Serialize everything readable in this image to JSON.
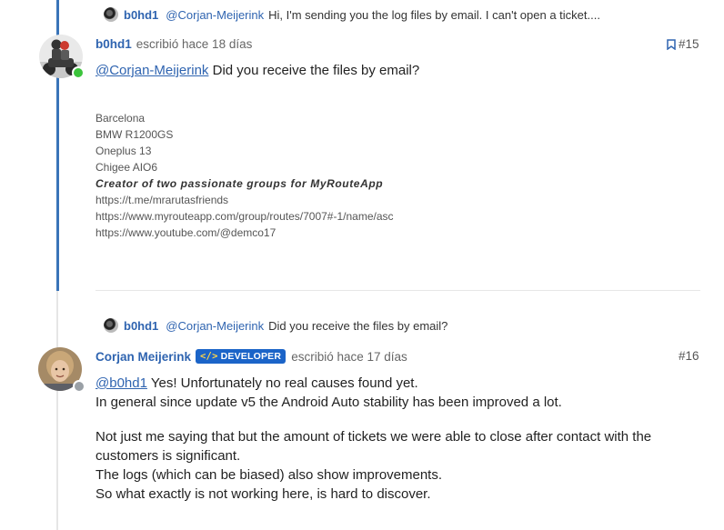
{
  "post1": {
    "reply_to": {
      "username": "b0hd1",
      "mention": "@Corjan-Meijerink",
      "text": "Hi, I'm sending you the log files by email. I can't open a ticket...."
    },
    "username": "b0hd1",
    "posted": "escribió hace 18 días",
    "number": "#15",
    "mention": "@Corjan-Meijerink",
    "text": " Did you receive the files by email?",
    "signature": {
      "lines": [
        "Barcelona",
        "BMW R1200GS",
        "Oneplus 13",
        "Chigee AIO6"
      ],
      "bold_line": "Creator of two passionate groups for MyRouteApp",
      "links": [
        "https://t.me/mrarutasfriends",
        "https://www.myrouteapp.com/group/routes/7007#-1/name/asc",
        "https://www.youtube.com/@demco17"
      ]
    }
  },
  "post2": {
    "reply_to": {
      "username": "b0hd1",
      "mention": "@Corjan-Meijerink",
      "text": "Did you receive the files by email?"
    },
    "username": "Corjan Meijerink",
    "badge": "DEVELOPER",
    "badge_icon": "</>",
    "posted": "escribió hace 17 días",
    "number": "#16",
    "mention": "@b0hd1",
    "p1_line1": " Yes! Unfortunately no real causes found yet.",
    "p1_line2": "In general since update v5 the Android Auto stability has been improved a lot.",
    "p2_line1": "Not just me saying that but the amount of tickets we were able to close after contact with the",
    "p2_line2": "customers is significant.",
    "p2_line3": "The logs (which can be biased) also show improvements.",
    "p2_line4": "So what exactly is not working here, is hard to discover."
  },
  "colors": {
    "link": "#2f64b0",
    "timeline": "#3a74b8",
    "online": "#3cc43c",
    "offline": "#9aa0a6",
    "badge": "#1b64c8"
  }
}
